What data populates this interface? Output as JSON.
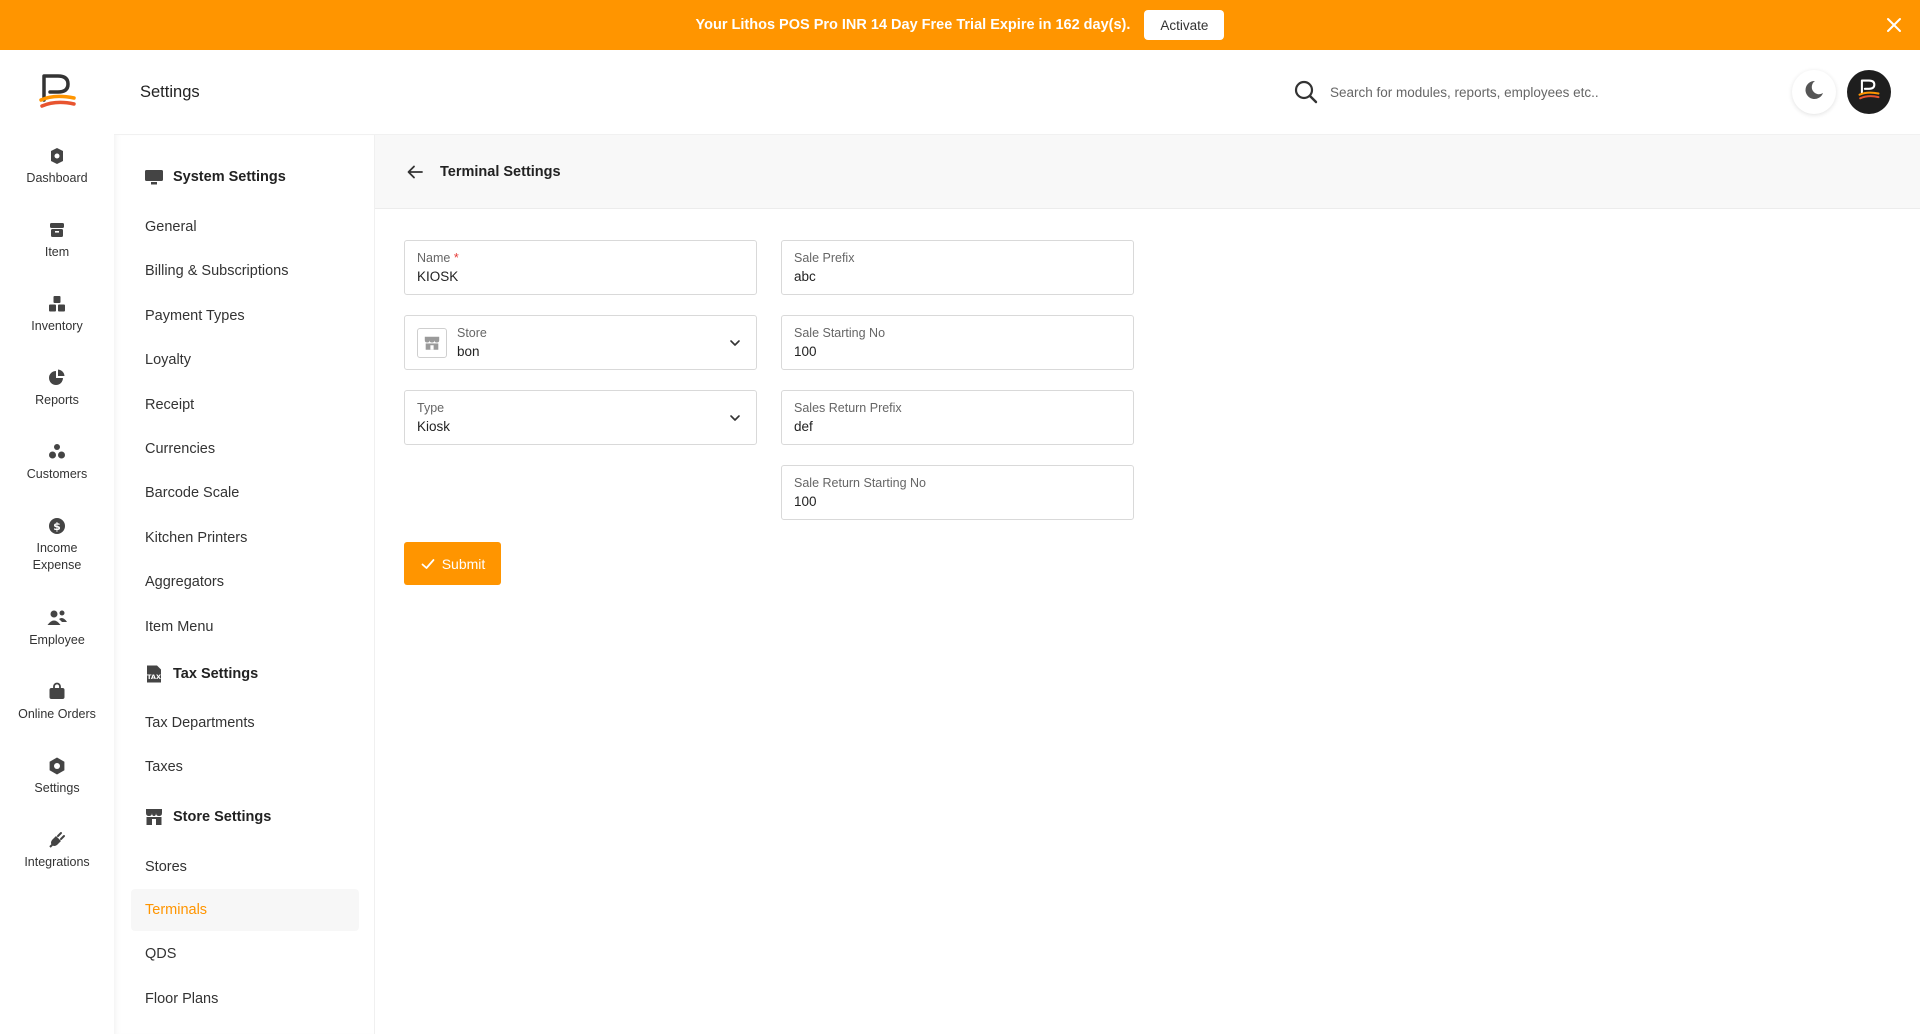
{
  "banner": {
    "text": "Your Lithos POS Pro INR 14 Day Free Trial Expire in 162 day(s).",
    "activate_label": "Activate",
    "color": "#ff9500"
  },
  "rail": {
    "items": [
      {
        "label": "Dashboard",
        "icon": "dashboard-icon"
      },
      {
        "label": "Item",
        "icon": "item-box-icon"
      },
      {
        "label": "Inventory",
        "icon": "inventory-icon"
      },
      {
        "label": "Reports",
        "icon": "pie-chart-icon"
      },
      {
        "label": "Customers",
        "icon": "customers-icon"
      },
      {
        "label": "Income Expense",
        "icon": "dollar-icon"
      },
      {
        "label": "Employee",
        "icon": "employee-icon"
      },
      {
        "label": "Online Orders",
        "icon": "bag-icon"
      },
      {
        "label": "Settings",
        "icon": "gear-icon"
      },
      {
        "label": "Integrations",
        "icon": "plug-icon"
      }
    ]
  },
  "topbar": {
    "title": "Settings",
    "search_placeholder": "Search for modules, reports, employees etc.."
  },
  "settings_nav": {
    "sections": [
      {
        "label": "System Settings",
        "icon": "monitor-icon",
        "links": [
          "General",
          "Billing & Subscriptions",
          "Payment Types",
          "Loyalty",
          "Receipt",
          "Currencies",
          "Barcode Scale",
          "Kitchen Printers",
          "Aggregators",
          "Item Menu"
        ]
      },
      {
        "label": "Tax Settings",
        "icon": "tax-icon",
        "links": [
          "Tax Departments",
          "Taxes"
        ]
      },
      {
        "label": "Store Settings",
        "icon": "store-icon",
        "links": [
          "Stores",
          "Terminals",
          "QDS",
          "Floor Plans"
        ]
      }
    ],
    "active": "Terminals",
    "active_color": "#ff9500"
  },
  "main": {
    "title": "Terminal Settings",
    "fields": {
      "name": {
        "label": "Name",
        "required_mark": "*",
        "value": "KIOSK"
      },
      "store": {
        "label": "Store",
        "value": "bon"
      },
      "type": {
        "label": "Type",
        "value": "Kiosk"
      },
      "sale_prefix": {
        "label": "Sale Prefix",
        "value": "abc"
      },
      "sale_starting_no": {
        "label": "Sale Starting No",
        "value": "100"
      },
      "sales_return_prefix": {
        "label": "Sales Return Prefix",
        "value": "def"
      },
      "sale_return_starting_no": {
        "label": "Sale Return Starting No",
        "value": "100"
      }
    },
    "submit_label": "Submit"
  }
}
